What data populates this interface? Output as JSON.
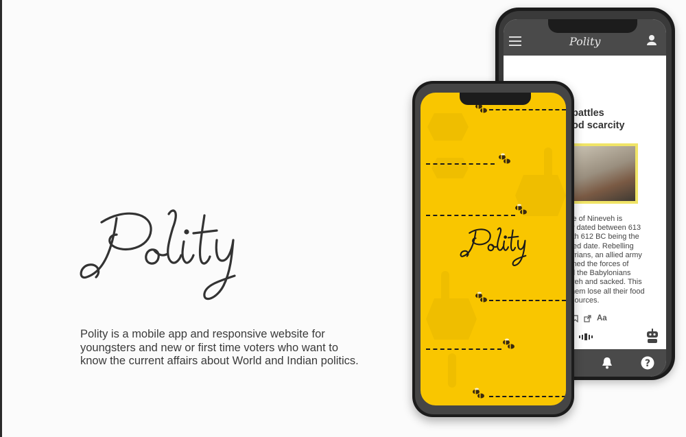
{
  "brand": {
    "name": "Polity"
  },
  "description": "Polity is a mobile app and responsive website for\nyoungsters and new or first time voters who want to\nknow the current affairs about World and Indian politics.",
  "back_phone": {
    "header_title": "Polity",
    "article_title_line1": "battles",
    "article_title_line2": "od scarcity",
    "article_body": "le of Nineveh is\ny dated between 613\nith 612 BC being the\nted date. Rebelling\nyrians, an allied army\nined the forces of\nd the Babylonians\nveh and sacked. This\nhem lose all their food\nsources.",
    "tool_font_label": "Aa",
    "icons": [
      "menu-icon",
      "user-icon",
      "bookmark-icon",
      "share-icon",
      "robot-icon",
      "bell-icon",
      "help-icon",
      "audio-wave-icon"
    ]
  },
  "front_phone": {
    "splash_logo": "Polity"
  },
  "colors": {
    "yellow": "#f9c600",
    "dark": "#1c1c1c",
    "bar": "#4a4a4a",
    "text": "#3a3a3a"
  }
}
